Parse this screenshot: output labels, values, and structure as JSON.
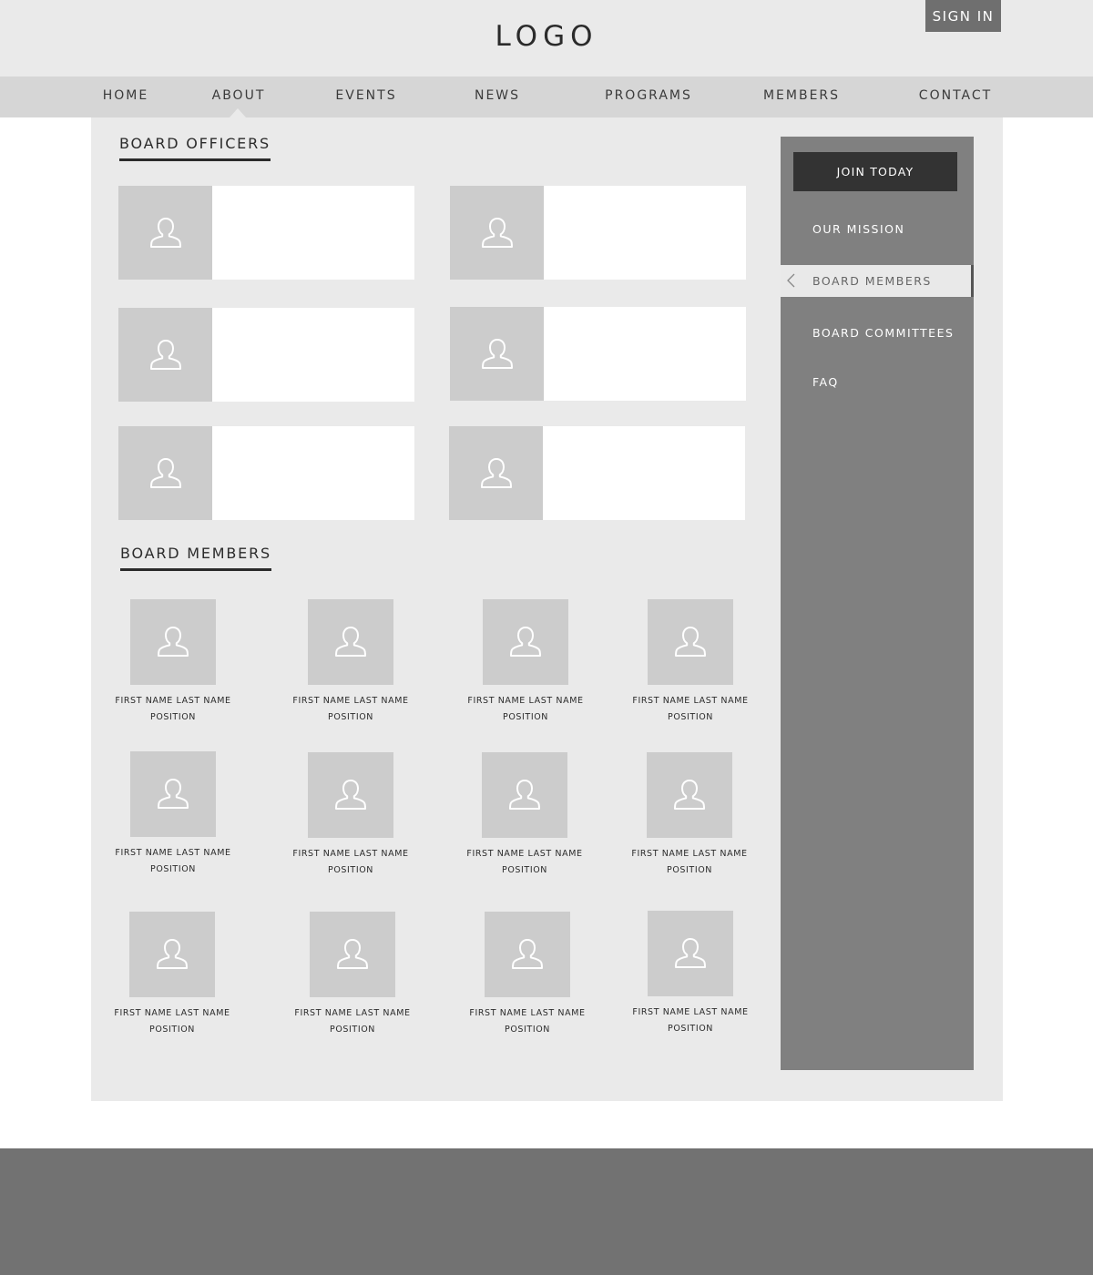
{
  "header": {
    "logo": "LOGO",
    "sign_in": "SIGN IN"
  },
  "nav": {
    "items": [
      "HOME",
      "ABOUT",
      "EVENTS",
      "NEWS",
      "PROGRAMS",
      "MEMBERS",
      "CONTACT"
    ],
    "active": "ABOUT"
  },
  "main": {
    "officers_title": "BOARD OFFICERS",
    "officer_count": 6,
    "members_title": "BOARD MEMBERS",
    "members": [
      {
        "name": "FIRST NAME LAST NAME",
        "position": "POSITION"
      },
      {
        "name": "FIRST NAME LAST NAME",
        "position": "POSITION"
      },
      {
        "name": "FIRST NAME LAST NAME",
        "position": "POSITION"
      },
      {
        "name": "FIRST NAME LAST NAME",
        "position": "POSITION"
      },
      {
        "name": "FIRST NAME LAST NAME",
        "position": "POSITION"
      },
      {
        "name": "FIRST NAME LAST NAME",
        "position": "POSITION"
      },
      {
        "name": "FIRST NAME LAST NAME",
        "position": "POSITION"
      },
      {
        "name": "FIRST NAME LAST NAME",
        "position": "POSITION"
      },
      {
        "name": "FIRST NAME LAST NAME",
        "position": "POSITION"
      },
      {
        "name": "FIRST NAME LAST NAME",
        "position": "POSITION"
      },
      {
        "name": "FIRST NAME LAST NAME",
        "position": "POSITION"
      },
      {
        "name": "FIRST NAME LAST NAME",
        "position": "POSITION"
      }
    ]
  },
  "sidebar": {
    "join_label": "JOIN TODAY",
    "items": [
      "OUR MISSION",
      "BOARD MEMBERS",
      "BOARD  COMMITTEES",
      "FAQ"
    ],
    "active": "BOARD MEMBERS"
  },
  "icons": {
    "avatar": "user-silhouette-icon",
    "back": "chevron-left-icon"
  },
  "colors": {
    "header_bg": "#eaeaea",
    "nav_bg": "#d6d6d6",
    "sign_in_bg": "#6f6f6f",
    "sidebar_bg": "#808080",
    "join_bg": "#333333",
    "photo_bg": "#cccccc",
    "footer_bg": "#727272"
  }
}
